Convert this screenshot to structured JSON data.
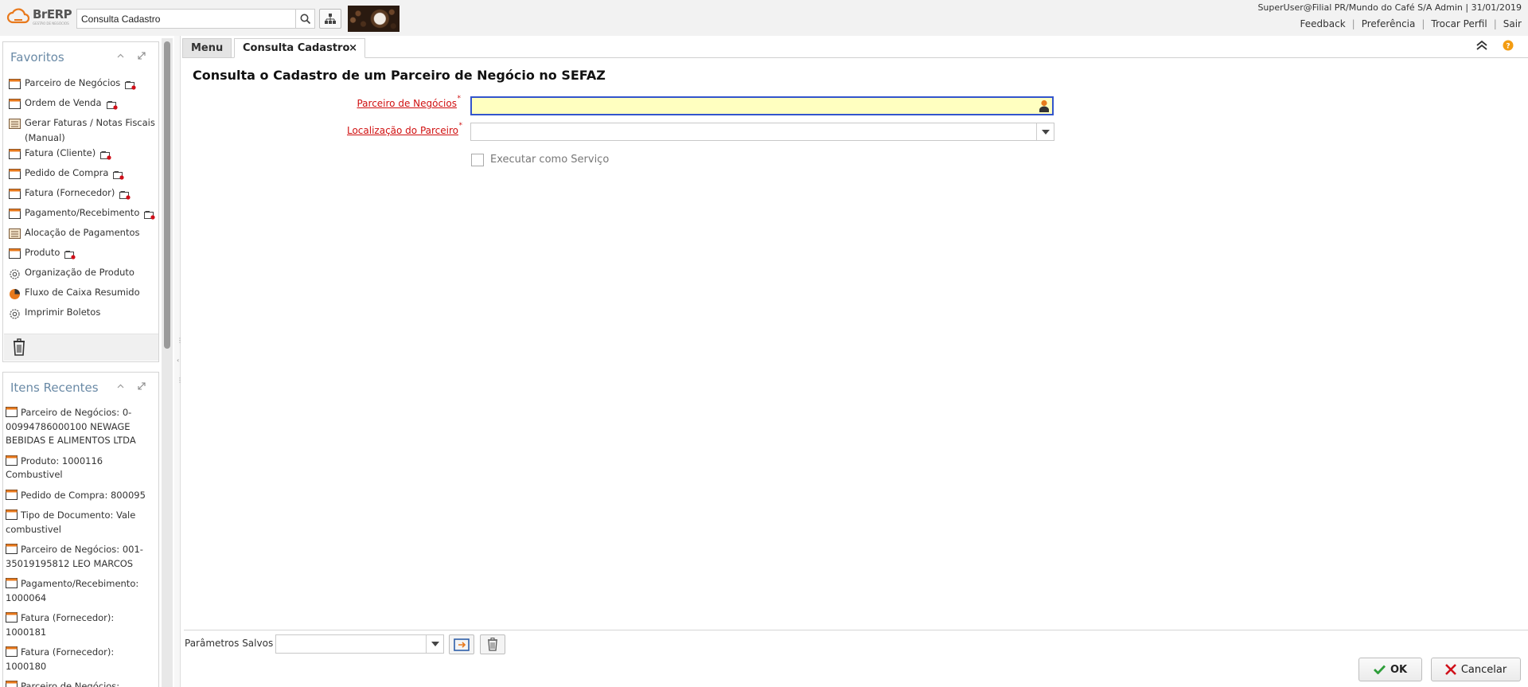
{
  "header": {
    "brand": "BrERP",
    "brand_tagline": "GESTÃO DE NEGÓCIOS",
    "search_value": "Consulta Cadastro",
    "user_info": "SuperUser@Filial PR/Mundo do Café S/A Admin | 31/01/2019",
    "links": [
      "Feedback",
      "Preferência",
      "Trocar Perfil",
      "Sair"
    ]
  },
  "favorites": {
    "title": "Favoritos",
    "items": [
      {
        "label": "Parceiro de Negócios",
        "icon": "window-icon",
        "extra": true
      },
      {
        "label": "Ordem de Venda",
        "icon": "window-icon",
        "extra": true
      },
      {
        "label": "Gerar Faturas / Notas Fiscais (Manual)",
        "icon": "form-icon",
        "extra": false
      },
      {
        "label": "Fatura (Cliente)",
        "icon": "window-icon",
        "extra": true
      },
      {
        "label": "Pedido de Compra",
        "icon": "window-icon",
        "extra": true
      },
      {
        "label": "Fatura (Fornecedor)",
        "icon": "window-icon",
        "extra": true
      },
      {
        "label": "Pagamento/Recebimento",
        "icon": "window-icon",
        "extra": true
      },
      {
        "label": "Alocação de Pagamentos",
        "icon": "form-icon",
        "extra": false
      },
      {
        "label": "Produto",
        "icon": "window-icon",
        "extra": true
      },
      {
        "label": "Organização de Produto",
        "icon": "process-icon",
        "extra": false
      },
      {
        "label": "Fluxo de Caixa Resumido",
        "icon": "report-icon",
        "extra": false
      },
      {
        "label": "Imprimir Boletos",
        "icon": "process-icon",
        "extra": false
      }
    ]
  },
  "recent": {
    "title": "Itens Recentes",
    "items": [
      "Parceiro de Negócios: 0-00994786000100 NEWAGE BEBIDAS E ALIMENTOS LTDA",
      "Produto: 1000116 Combustivel",
      "Pedido de Compra: 800095",
      "Tipo de Documento: Vale combustivel",
      "Parceiro de Negócios: 001-35019195812 LEO MARCOS",
      "Pagamento/Recebimento: 1000064",
      "Fatura (Fornecedor): 1000181",
      "Fatura (Fornecedor): 1000180",
      "Parceiro de Negócios:"
    ]
  },
  "tabs": {
    "menu": "Menu",
    "active": "Consulta Cadastro"
  },
  "form": {
    "title": "Consulta o Cadastro de um Parceiro de Negócio no SEFAZ",
    "bp_label": "Parceiro de Negócios",
    "bp_value": "",
    "location_label": "Localização do Parceiro",
    "location_value": "",
    "service_label": "Executar como Serviço",
    "service_checked": false
  },
  "footer": {
    "saved_label": "Parâmetros Salvos",
    "saved_value": "",
    "ok_label": "OK",
    "cancel_label": "Cancelar"
  }
}
